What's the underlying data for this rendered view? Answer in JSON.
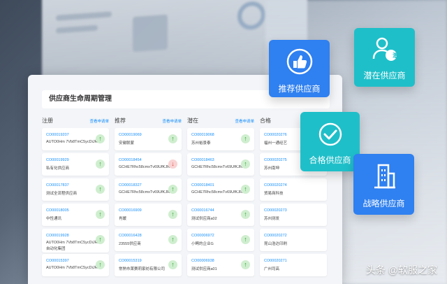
{
  "panel": {
    "title": "供应商生命周期管理"
  },
  "columns": [
    {
      "name": "注册",
      "link": "查看申请单",
      "cards": [
        {
          "code": "CO00019207",
          "desc": "AUTO0Hm 7Vb8TmC5ycDiJR0",
          "desc2": "",
          "dir": "up"
        },
        {
          "code": "CO00019929",
          "desc": "私有化供应商",
          "desc2": "",
          "dir": "up"
        },
        {
          "code": "CO00017837",
          "desc": "测试全流程供应商",
          "desc2": "",
          "dir": "up"
        },
        {
          "code": "CO00018005",
          "desc": "中性通讯",
          "desc2": "",
          "dir": "up"
        },
        {
          "code": "CO00019928",
          "desc": "AUTO0Hm 7Vb8TmC5ycDiJR0",
          "desc2": "自动化集团",
          "dir": "up"
        },
        {
          "code": "CO00015397",
          "desc": "AUTO0Hm 7Vb8TmC5ycDiJR0",
          "desc2": "",
          "dir": "up"
        }
      ]
    },
    {
      "name": "推荐",
      "link": "查看申请单",
      "cards": [
        {
          "code": "CO00019069",
          "desc": "安徽联蒙",
          "desc2": "",
          "dir": "up"
        },
        {
          "code": "CO00018454",
          "desc": "GCHE7Rhc58cmxTv69UfKJRd",
          "desc2": "",
          "dir": "down"
        },
        {
          "code": "CO00018327",
          "desc": "GCHE7Rhc58cmxTv69UfKJRd",
          "desc2": "",
          "dir": "up"
        },
        {
          "code": "CO00016909",
          "desc": "肖媛",
          "desc2": "",
          "dir": "up"
        },
        {
          "code": "CO00016428",
          "desc": "23555供应商",
          "desc2": "",
          "dir": "up"
        },
        {
          "code": "CO00015319",
          "desc": "常熟市莱赛莉家纺有限公司",
          "desc2": "",
          "dir": "up"
        }
      ]
    },
    {
      "name": "潜在",
      "link": "查看申请单",
      "cards": [
        {
          "code": "CO00019068",
          "desc": "苏州裕景泰",
          "desc2": "",
          "dir": "up"
        },
        {
          "code": "CO00018463",
          "desc": "GCHE7Rhc58cmxTv69UfKJRd",
          "desc2": "",
          "dir": "up"
        },
        {
          "code": "CO00018401",
          "desc": "GCHE7Rhc58cmxTv69UfKJRd",
          "desc2": "",
          "dir": "up"
        },
        {
          "code": "CO00016744",
          "desc": "测试供应商a02",
          "desc2": "",
          "dir": "up"
        },
        {
          "code": "CO00006972",
          "desc": "小鳄的企业G",
          "desc2": "",
          "dir": "up"
        },
        {
          "code": "CO00006938",
          "desc": "测试供应商a01",
          "desc2": "",
          "dir": "up"
        }
      ]
    },
    {
      "name": "合格",
      "link": "",
      "cards": [
        {
          "code": "CO00020276",
          "desc": "福州一通经艺",
          "desc2": "",
          "dir": ""
        },
        {
          "code": "CO00020275",
          "desc": "苏州南坤",
          "desc2": "",
          "dir": ""
        },
        {
          "code": "CO00020274",
          "desc": "贸易商科技",
          "desc2": "",
          "dir": ""
        },
        {
          "code": "CO00020273",
          "desc": "苏州测发",
          "desc2": "",
          "dir": ""
        },
        {
          "code": "CO00020272",
          "desc": "昆山浩达印刷",
          "desc2": "",
          "dir": ""
        },
        {
          "code": "CO00020271",
          "desc": "广州司高",
          "desc2": "",
          "dir": ""
        }
      ]
    }
  ],
  "tiles": {
    "recommended": "推荐供应商",
    "potential": "潜在供应商",
    "potential_badge": "潜",
    "qualified": "合格供应商",
    "strategic": "战略供应商"
  },
  "watermark": "头条 @软服之家",
  "colors": {
    "blue": "#2f80f0",
    "teal": "#1fbfc9",
    "link": "#1890ff",
    "up": "#33a133",
    "down": "#e04848"
  }
}
